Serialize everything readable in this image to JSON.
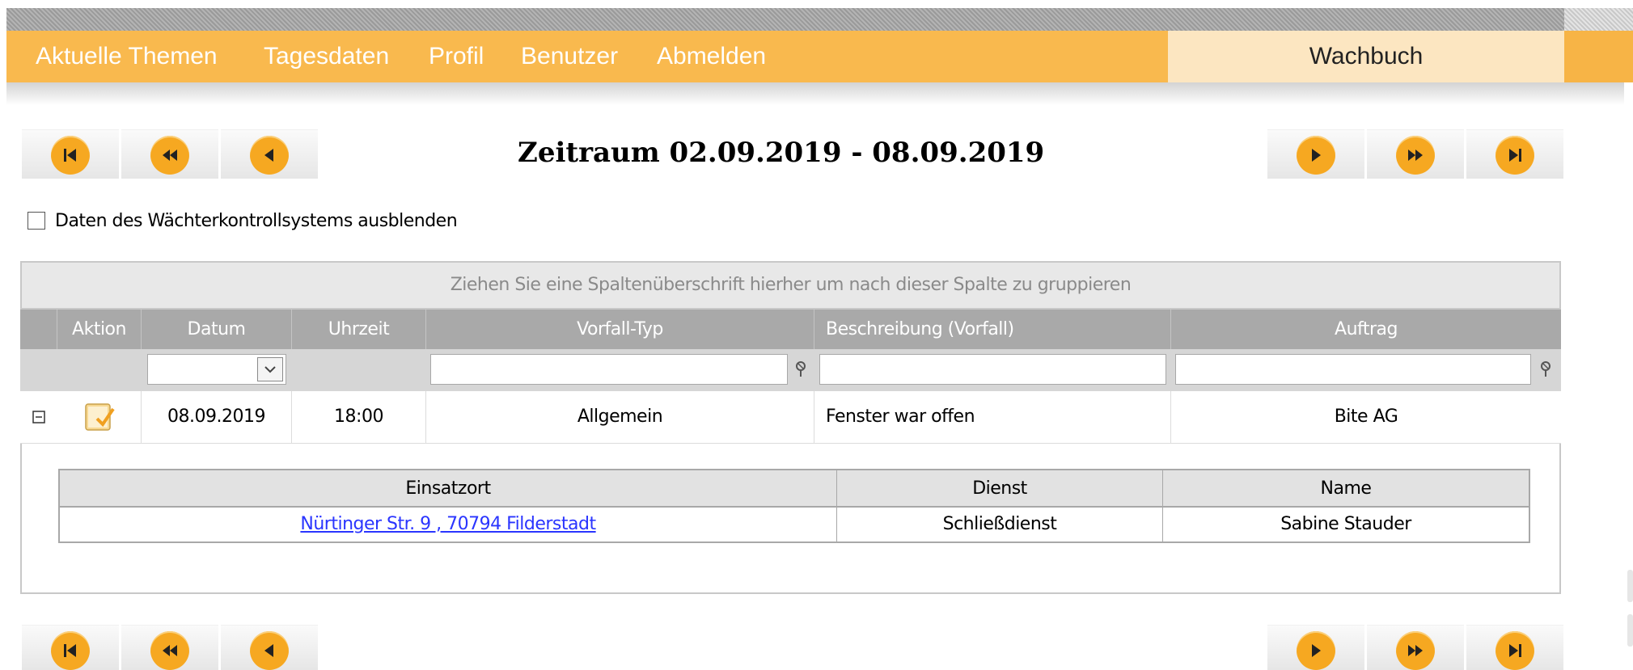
{
  "nav": {
    "items": [
      "Aktuelle Themen",
      "Tagesdaten",
      "Profil",
      "Benutzer",
      "Abmelden"
    ],
    "brand": "Wachbuch"
  },
  "pager": {
    "buttons": [
      "first-page",
      "previous-block",
      "previous-week",
      "next-week",
      "next-block",
      "last-page"
    ]
  },
  "period": {
    "title": "Zeitraum 02.09.2019 - 08.09.2019"
  },
  "options": {
    "hide_watch_control_label": "Daten des Wächterkontrollsystems ausblenden",
    "hide_watch_control_checked": false
  },
  "grid": {
    "group_hint": "Ziehen Sie eine Spaltenüberschrift hierher um nach dieser Spalte zu gruppieren",
    "columns": [
      "Aktion",
      "Datum",
      "Uhrzeit",
      "Vorfall-Typ",
      "Beschreibung (Vorfall)",
      "Auftrag"
    ],
    "filters": {
      "datum": "",
      "vorfall_typ": "",
      "beschreibung": "",
      "auftrag": ""
    },
    "rows": [
      {
        "expanded": true,
        "datum": "08.09.2019",
        "uhrzeit": "18:00",
        "vorfall_typ": "Allgemein",
        "beschreibung": "Fenster war offen",
        "auftrag": "Bite AG",
        "detail": {
          "columns": [
            "Einsatzort",
            "Dienst",
            "Name"
          ],
          "rows": [
            {
              "einsatzort": "Nürtinger Str. 9 , 70794 Filderstadt",
              "dienst": "Schließdienst",
              "name": "Sabine Stauder"
            }
          ]
        }
      }
    ]
  },
  "colors": {
    "nav_orange": "#f9b94e",
    "pager_orange": "#f6a821",
    "header_gray": "#a9a9a9",
    "link_blue": "#2a35ff"
  }
}
